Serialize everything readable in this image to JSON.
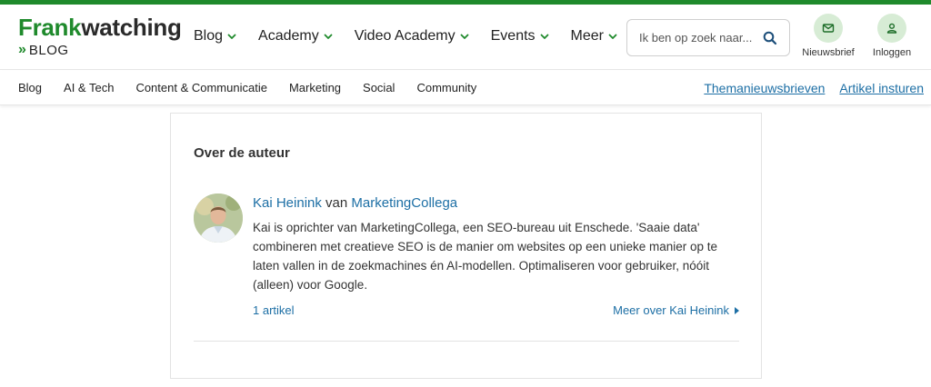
{
  "brand": {
    "name_part1": "Frank",
    "name_part2": "watching",
    "sub_chevron": "»",
    "sub_label": "BLOG",
    "accent_color": "#1f8a2c",
    "link_color": "#1d6fa5"
  },
  "main_nav": {
    "items": [
      {
        "label": "Blog"
      },
      {
        "label": "Academy"
      },
      {
        "label": "Video Academy"
      },
      {
        "label": "Events"
      },
      {
        "label": "Meer"
      }
    ]
  },
  "search": {
    "placeholder": "Ik ben op zoek naar...",
    "icon": "search-icon"
  },
  "header_actions": {
    "newsletter_label": "Nieuwsbrief",
    "newsletter_icon": "mail-icon",
    "login_label": "Inloggen",
    "login_icon": "user-icon"
  },
  "sub_nav": {
    "items": [
      {
        "label": "Blog"
      },
      {
        "label": "AI & Tech"
      },
      {
        "label": "Content & Communicatie"
      },
      {
        "label": "Marketing"
      },
      {
        "label": "Social"
      },
      {
        "label": "Community"
      }
    ],
    "right_links": [
      {
        "label": "Themanieuwsbrieven"
      },
      {
        "label": "Artikel insturen"
      }
    ]
  },
  "author_card": {
    "heading": "Over de auteur",
    "author_name": "Kai Heinink",
    "connector": "van",
    "company": "MarketingCollega",
    "bio": "Kai is oprichter van MarketingCollega, een SEO-bureau uit Enschede. 'Saaie data' combineren met creatieve SEO is de manier om websites op een unieke manier op te laten vallen in de zoekmachines én AI-modellen. Optimaliseren voor gebruiker, nóóit (alleen) voor Google.",
    "article_count": "1 artikel",
    "more_link": "Meer over Kai Heinink"
  }
}
